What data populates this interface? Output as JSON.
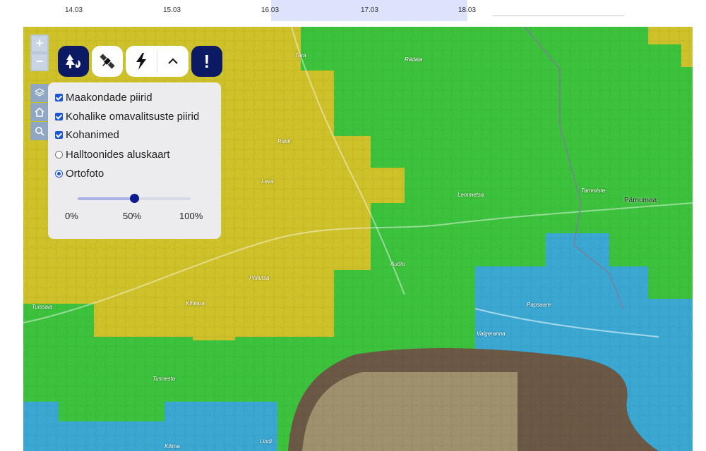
{
  "timeline": {
    "dates": [
      "14.03",
      "15.03",
      "16.03",
      "17.03",
      "18.03"
    ],
    "selected_range": [
      "16.03",
      "18.03"
    ]
  },
  "zoom": {
    "plus": "+",
    "minus": "−"
  },
  "toolbar": {
    "forest_fire_button": "forest-fire-icon",
    "satellite_button": "satellite-icon",
    "lightning_button": "lightning-icon",
    "collapse_button": "chevron-up-icon",
    "alert_button": "!"
  },
  "side_tools": [
    "layers-icon",
    "home-icon",
    "search-icon"
  ],
  "layers": {
    "options": [
      {
        "type": "checkbox",
        "label": "Maakondade piirid",
        "checked": true
      },
      {
        "type": "checkbox",
        "label": "Kohalike omavalitsuste piirid",
        "checked": true
      },
      {
        "type": "checkbox",
        "label": "Kohanimed",
        "checked": true
      },
      {
        "type": "radio",
        "label": "Halltoonides aluskaart",
        "checked": false
      },
      {
        "type": "radio",
        "label": "Ortofoto",
        "checked": true
      }
    ],
    "opacity_percent": 50,
    "opacity_ticks": [
      "0%",
      "50%",
      "100%"
    ]
  },
  "map": {
    "colors": {
      "yellow": "#cdbf25",
      "green": "#3fc23c",
      "blue": "#3aa8d2",
      "water": "#6e5a45",
      "accent": "#0b1a62"
    },
    "places": [
      "Tara",
      "Rädala",
      "Raidi",
      "Leva",
      "Lemmetsa",
      "Tammiste",
      "Pärnumaa",
      "Pöllutsa",
      "Audru",
      "Tuissaia",
      "Kihlepa",
      "Papsaare",
      "Valgeranna",
      "Tusnesto",
      "Kliima",
      "Lindi"
    ]
  }
}
